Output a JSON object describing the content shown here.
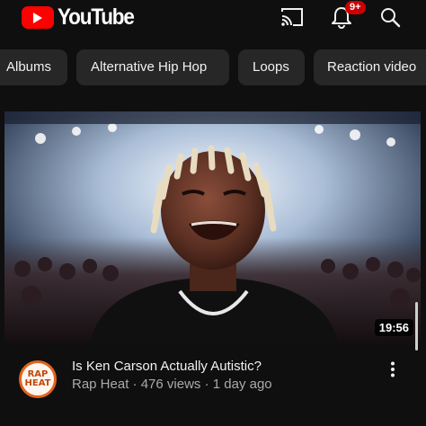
{
  "header": {
    "logo_text": "YouTube",
    "notification_count": "9+",
    "icons": [
      "cast-icon",
      "bell-icon",
      "search-icon"
    ],
    "brand_color": "#ff0000"
  },
  "chips": [
    {
      "label": "Albums"
    },
    {
      "label": "Alternative Hip Hop"
    },
    {
      "label": "Loops"
    },
    {
      "label": "Reaction video"
    }
  ],
  "video": {
    "duration": "19:56",
    "title": "Is Ken Carson Actually Autistic?",
    "channel": "Rap Heat",
    "views": "476 views",
    "age": "1 day ago",
    "meta_sep": "·"
  },
  "channel_avatar": {
    "line1": "RAP",
    "line2": "HEAT"
  }
}
